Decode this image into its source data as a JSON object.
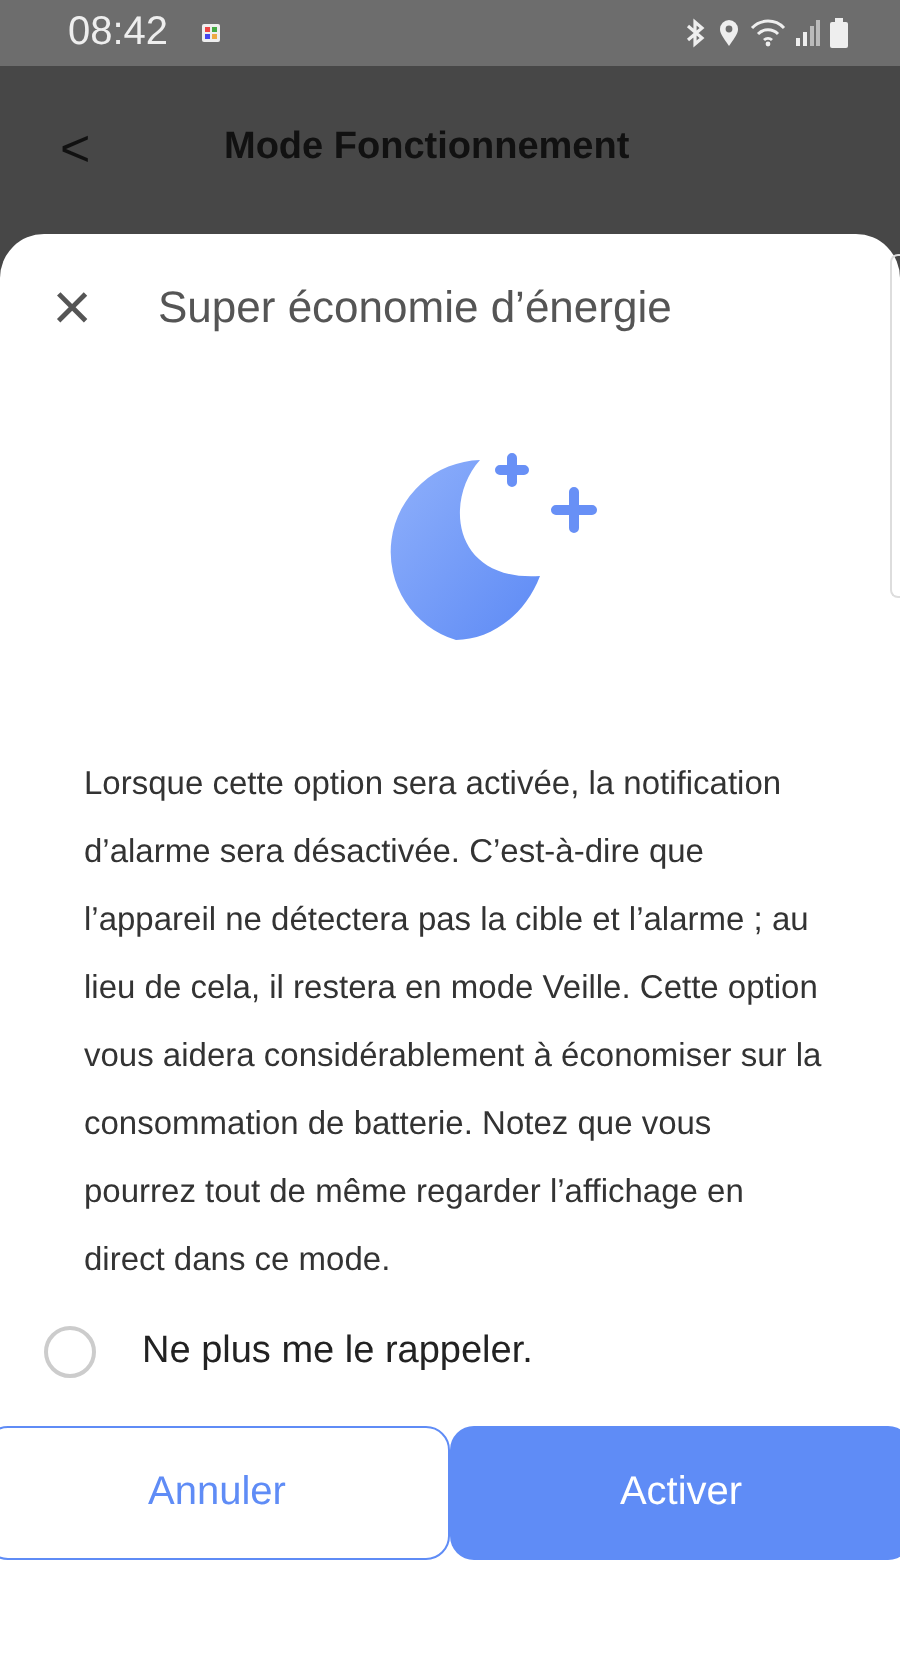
{
  "status_bar": {
    "time": "08:42"
  },
  "header": {
    "back": "<",
    "title": "Mode Fonctionnement"
  },
  "dialog": {
    "close": "×",
    "title": "Super économie d’énergie",
    "body": "Lorsque cette option sera activée, la notification d’alarme sera désactivée. C’est-à-dire que l’appareil ne détectera pas la cible et l’alarme ; au lieu de cela, il restera en mode Veille. Cette option vous aidera considérablement à économiser sur la consommation de batterie. Notez que vous pourrez tout de même regarder l’affichage en direct dans ce mode.",
    "option": {
      "label": "Ne plus me le rappeler.",
      "checked": false
    },
    "buttons": [
      {
        "label": "Annuler",
        "kind": "secondary"
      },
      {
        "label": "Activer",
        "kind": "primary"
      }
    ]
  }
}
